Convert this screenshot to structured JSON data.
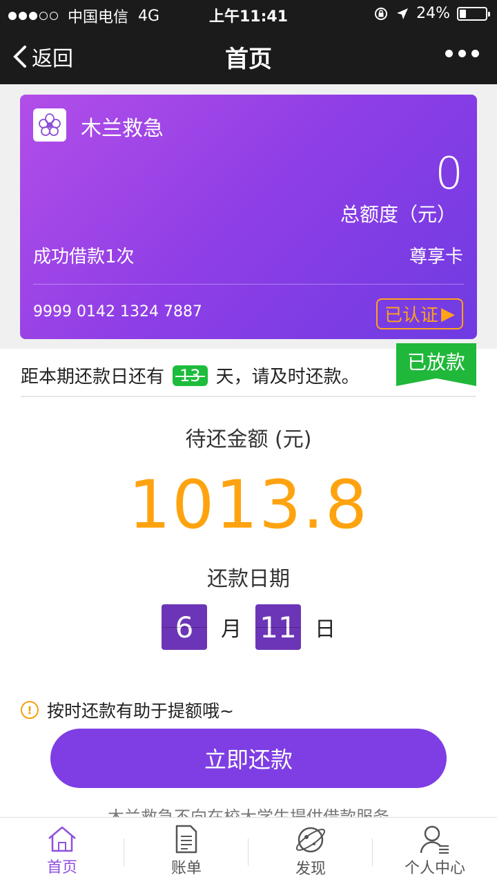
{
  "status_bar": {
    "carrier": "中国电信",
    "network": "4G",
    "time": "上午11:41",
    "battery": "24%",
    "battery_level": 0.24
  },
  "nav": {
    "back_label": "返回",
    "title": "首页"
  },
  "card": {
    "name": "木兰救急",
    "total_amount": "0",
    "total_amount_label": "总额度（元）",
    "loans_text": "成功借款1次",
    "tier": "尊享卡",
    "number": "9999 0142 1324 7887",
    "verified_label": "已认证",
    "verified_arrow": "▶"
  },
  "loan": {
    "countdown_prefix": "距本期还款日还有",
    "countdown_days": "13",
    "countdown_suffix": "天，请及时还款。",
    "status_ribbon": "已放款",
    "pending_label": "待还金额 (元)",
    "pending_amount": "1013.8",
    "date_label": "还款日期",
    "month": "6",
    "month_unit": "月",
    "day": "11",
    "day_unit": "日",
    "tip": "按时还款有助于提额哦~",
    "repay_button": "立即还款",
    "footnote": "木兰救急不向在校大学生提供借款服务"
  },
  "tabs": [
    {
      "label": "首页",
      "icon": "home-icon"
    },
    {
      "label": "账单",
      "icon": "bill-icon"
    },
    {
      "label": "发现",
      "icon": "discover-icon"
    },
    {
      "label": "个人中心",
      "icon": "profile-icon"
    }
  ],
  "colors": {
    "accent": "#7e3ee3",
    "amount": "#fea30f",
    "green": "#1fb83a",
    "active_tab": "#8f4fe0"
  }
}
